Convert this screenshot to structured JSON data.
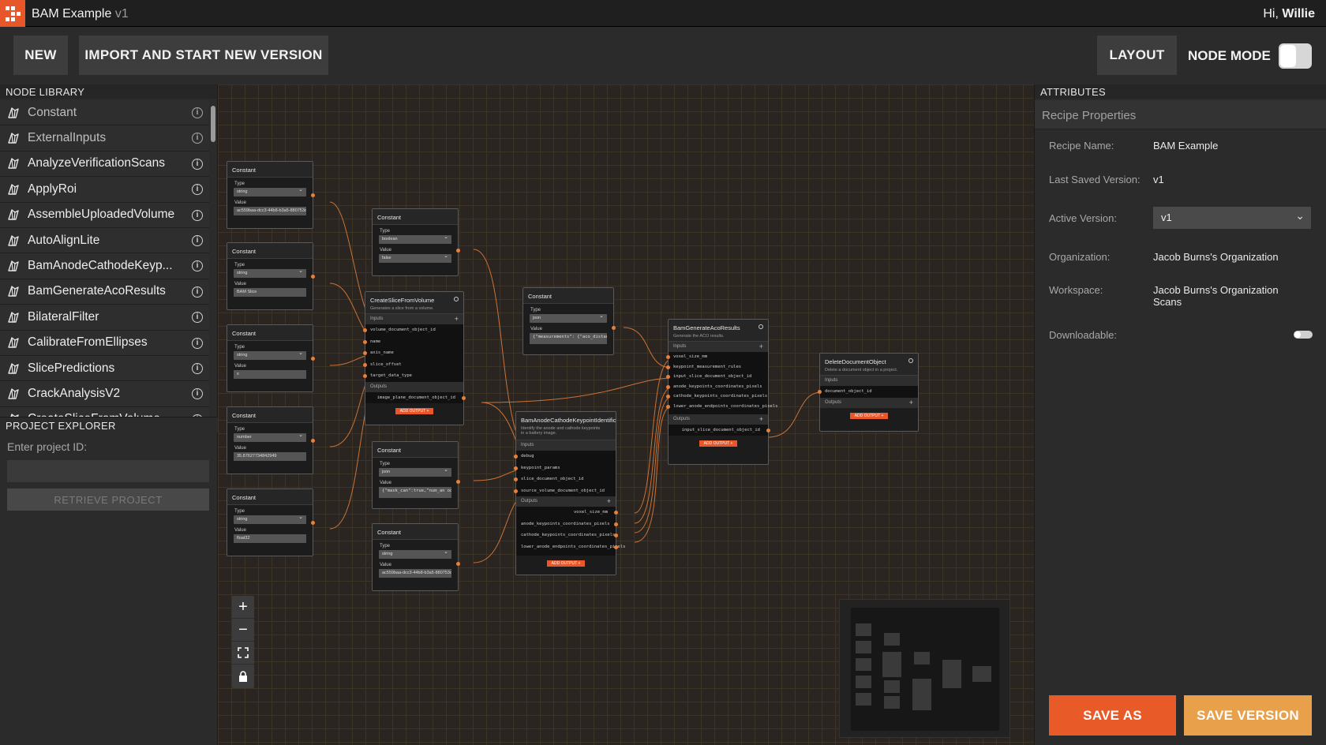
{
  "app": {
    "title": "BAM Example",
    "version": "v1",
    "greeting_prefix": "Hi,",
    "user": "Willie"
  },
  "toolbar": {
    "new_label": "NEW",
    "import_label": "IMPORT AND START NEW VERSION",
    "layout_label": "LAYOUT",
    "node_mode_label": "NODE MODE",
    "node_mode_on": false
  },
  "node_library": {
    "header": "NODE LIBRARY",
    "items": [
      {
        "label": "Constant"
      },
      {
        "label": "ExternalInputs"
      },
      {
        "label": "AnalyzeVerificationScans"
      },
      {
        "label": "ApplyRoi"
      },
      {
        "label": "AssembleUploadedVolume"
      },
      {
        "label": "AutoAlignLite"
      },
      {
        "label": "BamAnodeCathodeKeyp..."
      },
      {
        "label": "BamGenerateAcoResults"
      },
      {
        "label": "BilateralFilter"
      },
      {
        "label": "CalibrateFromEllipses"
      },
      {
        "label": "SlicePredictions"
      },
      {
        "label": "CrackAnalysisV2"
      },
      {
        "label": "CreateSliceFromVolume"
      }
    ]
  },
  "project_explorer": {
    "header": "PROJECT EXPLORER",
    "input_label": "Enter project ID:",
    "input_value": "",
    "retrieve_label": "RETRIEVE PROJECT"
  },
  "canvas": {
    "type_label": "Type",
    "value_label": "Value",
    "inputs_label": "Inputs",
    "outputs_label": "Outputs",
    "add_output_label": "ADD OUTPUT +",
    "constants": [
      {
        "title": "Constant",
        "type": "string",
        "value": "ac559baa-dcc3-44b8-b3a5-880753c"
      },
      {
        "title": "Constant",
        "type": "string",
        "value": "BAM Slice"
      },
      {
        "title": "Constant",
        "type": "string",
        "value": "x"
      },
      {
        "title": "Constant",
        "type": "number",
        "value": "35.87627734842949"
      },
      {
        "title": "Constant",
        "type": "string",
        "value": "float32"
      },
      {
        "title": "Constant",
        "type": "boolean",
        "value": "false"
      },
      {
        "title": "Constant",
        "type": "json",
        "value": "{\"measurements\": {\"aco_distance\":"
      },
      {
        "title": "Constant",
        "type": "json",
        "value": "{\"mask_can\":true,\"num_an odes\":35,\"anode_scale\":0"
      },
      {
        "title": "Constant",
        "type": "string",
        "value": "ac559baa-dcc3-44b8-b3a5-880753c"
      }
    ],
    "create_slice": {
      "title": "CreateSliceFromVolume",
      "description": "Generates a slice from a volume.",
      "inputs": [
        "volume_document_object_id",
        "name",
        "axis_name",
        "slice_offset",
        "target_data_type"
      ],
      "outputs": [
        "image_plane_document_object_id"
      ]
    },
    "keypoint": {
      "title": "BamAnodeCathodeKeypointIdentification",
      "description": "Identify the anode and cathode keypoints in a battery image.",
      "inputs": [
        "debug",
        "keypoint_params",
        "slice_document_object_id",
        "source_volume_document_object_id"
      ],
      "outputs": [
        "voxel_size_mm",
        "anode_keypoints_coordinates_pixels",
        "cathode_keypoints_coordinates_pixels",
        "lower_anode_endpoints_coordinates_pixels"
      ]
    },
    "aco": {
      "title": "BamGenerateAcoResults",
      "description": "Generate the ACO results.",
      "inputs": [
        "voxel_size_mm",
        "keypoint_measurement_rules",
        "input_slice_document_object_id",
        "anode_keypoints_coordinates_pixels",
        "cathode_keypoints_coordinates_pixels",
        "lower_anode_endpoints_coordinates_pixels"
      ],
      "outputs": [
        "input_slice_document_object_id"
      ]
    },
    "delete_doc": {
      "title": "DeleteDocumentObject",
      "description": "Delete a document object in a project.",
      "inputs": [
        "document_object_id"
      ],
      "outputs": []
    },
    "wire_color": "#e8803a"
  },
  "attributes": {
    "header": "ATTRIBUTES",
    "section_title": "Recipe Properties",
    "recipe_name_label": "Recipe Name:",
    "recipe_name": "BAM Example",
    "last_saved_label": "Last Saved Version:",
    "last_saved": "v1",
    "active_version_label": "Active Version:",
    "active_version": "v1",
    "organization_label": "Organization:",
    "organization": "Jacob Burns's Organization",
    "workspace_label": "Workspace:",
    "workspace": "Jacob Burns's Organization Scans",
    "downloadable_label": "Downloadable:",
    "downloadable": false,
    "save_as_label": "SAVE AS",
    "save_version_label": "SAVE VERSION"
  },
  "colors": {
    "accent": "#e8572a",
    "save_version": "#e8a04a"
  }
}
